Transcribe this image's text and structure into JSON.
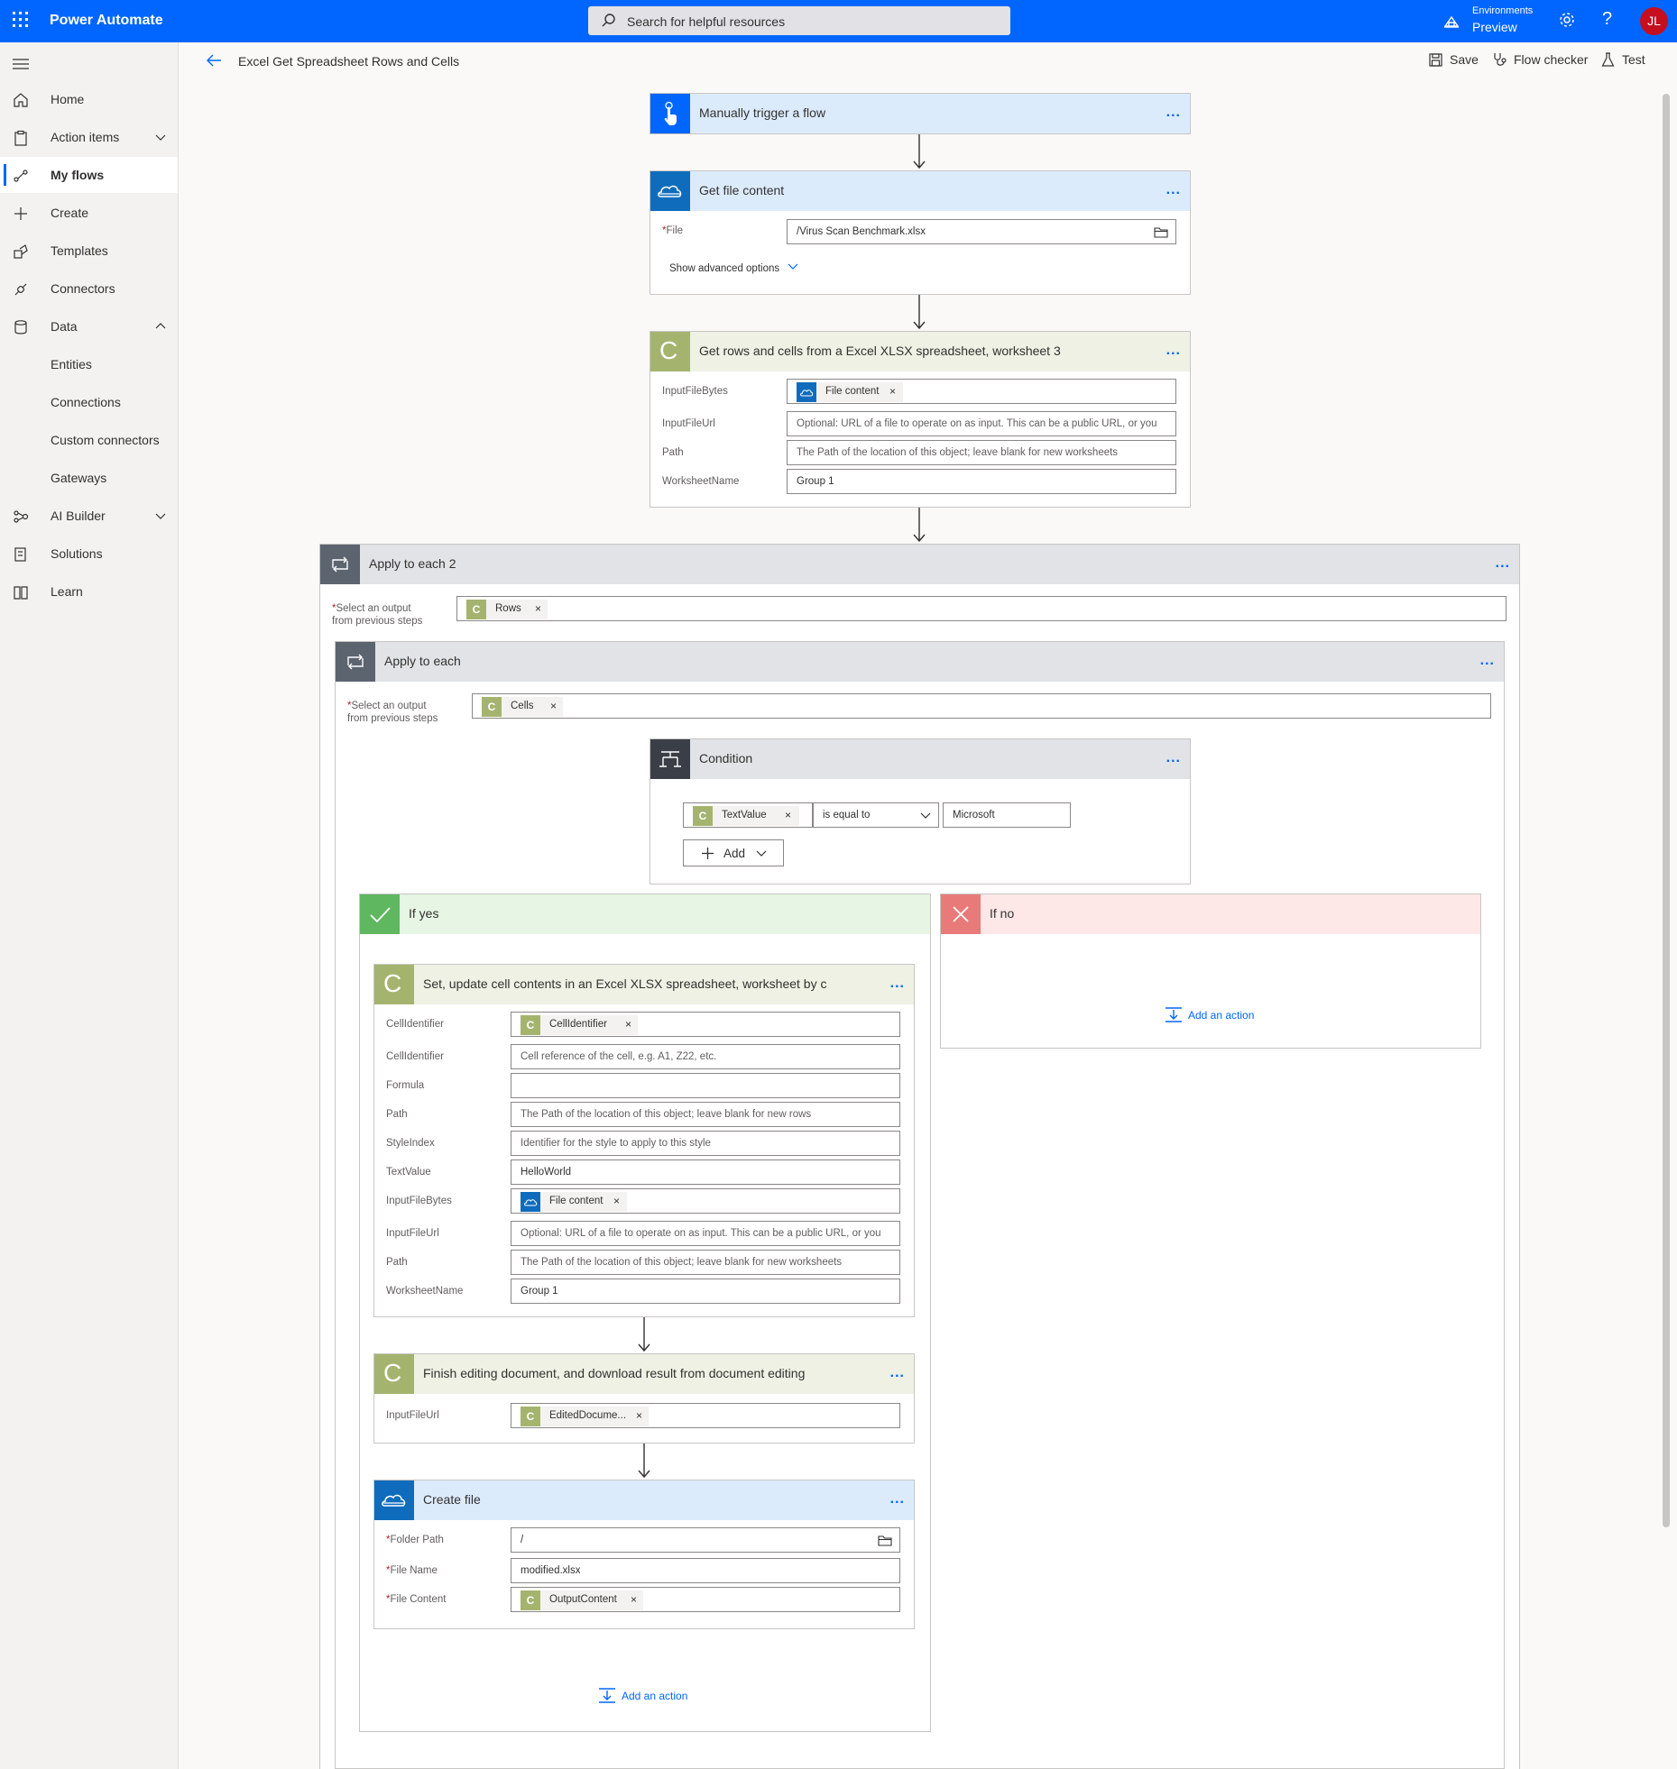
{
  "topbar": {
    "app_name": "Power Automate",
    "search_placeholder": "Search for helpful resources",
    "env_label": "Environments",
    "env_name": "Preview",
    "help": "?",
    "avatar_initials": "JL",
    "accent_color": "#0066ff"
  },
  "sidebar": {
    "items": [
      {
        "label": "Home",
        "icon": "home-icon"
      },
      {
        "label": "Action items",
        "icon": "clipboard-icon"
      },
      {
        "label": "My flows",
        "icon": "flow-icon"
      },
      {
        "label": "Create",
        "icon": "plus-icon"
      },
      {
        "label": "Templates",
        "icon": "templates-icon"
      },
      {
        "label": "Connectors",
        "icon": "connector-icon"
      },
      {
        "label": "Data",
        "icon": "database-icon"
      },
      {
        "label": "Entities"
      },
      {
        "label": "Connections"
      },
      {
        "label": "Custom connectors"
      },
      {
        "label": "Gateways"
      },
      {
        "label": "AI Builder",
        "icon": "ai-builder-icon"
      },
      {
        "label": "Solutions",
        "icon": "solutions-icon"
      },
      {
        "label": "Learn",
        "icon": "book-icon"
      }
    ]
  },
  "commandbar": {
    "flow_title": "Excel Get Spreadsheet Rows and Cells",
    "save": "Save",
    "flow_checker": "Flow checker",
    "test": "Test"
  },
  "steps": {
    "trigger": {
      "title": "Manually trigger a flow",
      "more": "..."
    },
    "get_file": {
      "title": "Get file content",
      "more": "...",
      "file_label": "File",
      "required": "*",
      "file_value": "/Virus Scan Benchmark.xlsx",
      "advanced": "Show advanced options"
    },
    "get_rows": {
      "title": "Get rows and cells from a Excel XLSX spreadsheet, worksheet 3",
      "more": "...",
      "icon_letter": "C",
      "input_bytes_label": "InputFileBytes",
      "input_bytes_token": "File content",
      "input_url_label": "InputFileUrl",
      "input_url_placeholder": "Optional: URL of a file to operate on as input. This can be a public URL, or you",
      "path_label": "Path",
      "path_placeholder": "The Path of the location of this object; leave blank for new worksheets",
      "worksheet_label": "WorksheetName",
      "worksheet_value": "Group 1"
    },
    "apply2": {
      "title": "Apply to each 2",
      "more": "...",
      "select_label_1": "Select an output",
      "select_label_2": "from previous steps",
      "token": "Rows",
      "token_letter": "C"
    },
    "apply": {
      "title": "Apply to each",
      "more": "...",
      "select_label_1": "Select an output",
      "select_label_2": "from previous steps",
      "token": "Cells",
      "token_letter": "C"
    },
    "condition": {
      "title": "Condition",
      "more": "...",
      "token": "TextValue",
      "token_letter": "C",
      "operator": "is equal to",
      "value": "Microsoft",
      "add": "Add"
    },
    "if_yes": {
      "title": "If yes"
    },
    "if_no": {
      "title": "If no",
      "add_action": "Add an action"
    },
    "set_cell": {
      "title": "Set, update cell contents in an Excel XLSX spreadsheet, worksheet by c",
      "more": "...",
      "icon_letter": "C",
      "rows": [
        {
          "label": "CellIdentifier",
          "token": "CellIdentifier"
        },
        {
          "label": "CellIdentifier",
          "placeholder": "Cell reference of the cell, e.g. A1, Z22, etc."
        },
        {
          "label": "Formula",
          "value": ""
        },
        {
          "label": "Path",
          "placeholder": "The Path of the location of this object; leave blank for new rows"
        },
        {
          "label": "StyleIndex",
          "placeholder": "Identifier for the style to apply to this style"
        },
        {
          "label": "TextValue",
          "value": "HelloWorld"
        },
        {
          "label": "InputFileBytes",
          "token": "File content"
        },
        {
          "label": "InputFileUrl",
          "placeholder": "Optional: URL of a file to operate on as input. This can be a public URL, or you"
        },
        {
          "label": "Path",
          "placeholder": "The Path of the location of this object; leave blank for new worksheets"
        },
        {
          "label": "WorksheetName",
          "value": "Group 1"
        }
      ]
    },
    "finish": {
      "title": "Finish editing document, and download result from document editing",
      "more": "...",
      "icon_letter": "C",
      "input_url_label": "InputFileUrl",
      "token": "EditedDocume..."
    },
    "create_file": {
      "title": "Create file",
      "more": "...",
      "required": "*",
      "folder_label": "Folder Path",
      "folder_value": "/",
      "name_label": "File Name",
      "name_value": "modified.xlsx",
      "content_label": "File Content",
      "content_token": "OutputContent",
      "token_letter": "C"
    },
    "yes_add_action": "Add an action"
  },
  "colors": {
    "blue": "#0066ff",
    "onedrive": "#0f6cbd",
    "custom_connector": "#a4b46f",
    "control": "#5c6470",
    "condition": "#3a3f47",
    "yes": "#5fb85f",
    "no": "#e87a7a"
  }
}
